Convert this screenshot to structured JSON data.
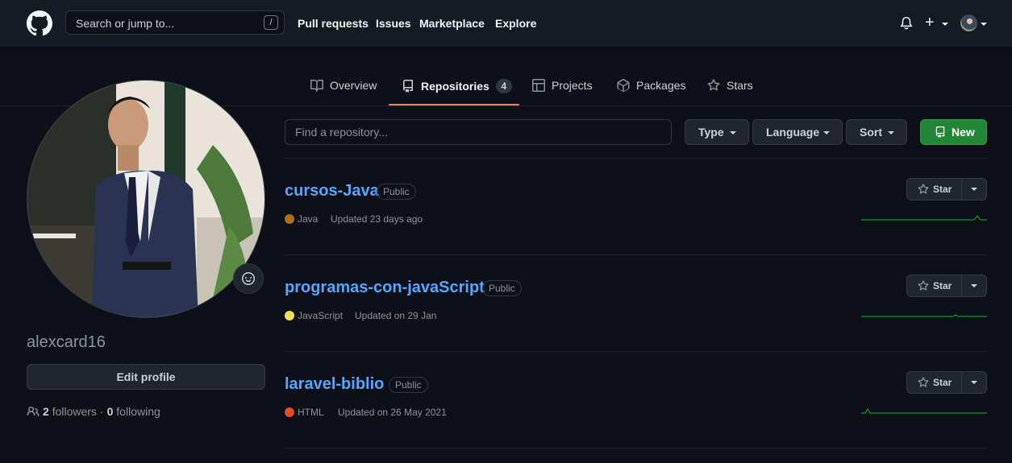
{
  "header": {
    "search_placeholder": "Search or jump to...",
    "search_shortcut": "/",
    "nav": [
      "Pull requests",
      "Issues",
      "Marketplace",
      "Explore"
    ]
  },
  "tabs": [
    {
      "label": "Overview",
      "icon": "book-icon"
    },
    {
      "label": "Repositories",
      "icon": "repo-icon",
      "count": "4"
    },
    {
      "label": "Projects",
      "icon": "table-icon"
    },
    {
      "label": "Packages",
      "icon": "package-icon"
    },
    {
      "label": "Stars",
      "icon": "star-icon"
    }
  ],
  "profile": {
    "username": "alexcard16",
    "edit_label": "Edit profile",
    "followers_count": "2",
    "followers_label": "followers",
    "separator": "·",
    "following_count": "0",
    "following_label": "following"
  },
  "filters": {
    "find_placeholder": "Find a repository...",
    "type_label": "Type",
    "language_label": "Language",
    "sort_label": "Sort",
    "new_label": "New"
  },
  "repos": [
    {
      "name": "cursos-Java",
      "visibility": "Public",
      "language": "Java",
      "language_color": "#b07219",
      "updated": "Updated 23 days ago",
      "star_label": "Star"
    },
    {
      "name": "programas-con-javaScript",
      "visibility": "Public",
      "language": "JavaScript",
      "language_color": "#f1e05a",
      "updated": "Updated on 29 Jan",
      "star_label": "Star"
    },
    {
      "name": "laravel-biblio",
      "visibility": "Public",
      "language": "HTML",
      "language_color": "#e34c26",
      "updated": "Updated on 26 May 2021",
      "star_label": "Star"
    }
  ]
}
